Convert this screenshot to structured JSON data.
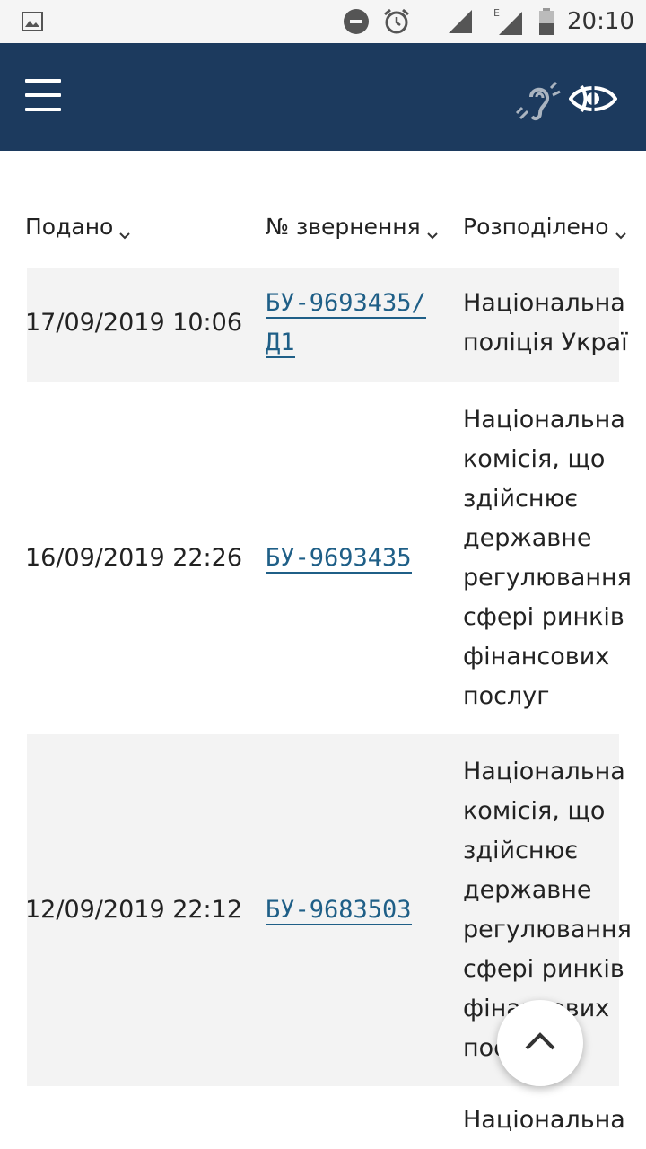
{
  "status_bar": {
    "time": "20:10",
    "network_label": "E",
    "icons": [
      "gallery-icon",
      "do-not-disturb-icon",
      "alarm-icon",
      "signal-icon",
      "signal-icon",
      "battery-icon"
    ]
  },
  "header": {
    "menu_icon": "hamburger-menu-icon",
    "accessibility_icons": [
      "hearing-accessibility-icon",
      "vision-accessibility-icon"
    ],
    "background_color": "#1c3a5e"
  },
  "table": {
    "columns": [
      "Подано",
      "№ звернення",
      "Розподілено"
    ],
    "rows": [
      {
        "submitted": "17/09/2019 10:06",
        "number": "БУ-9693435/Д1",
        "number_line1": "БУ-9693435/",
        "number_line2": "Д1",
        "distributed_lines": [
          "Національна",
          "поліція Украї"
        ]
      },
      {
        "submitted": "16/09/2019 22:26",
        "number": "БУ-9693435",
        "distributed_lines": [
          "Національна",
          "комісія, що",
          "здійснює",
          "державне",
          "регулювання",
          "сфері ринків",
          "фінансових",
          "послуг"
        ]
      },
      {
        "submitted": "12/09/2019 22:12",
        "number": "БУ-9683503",
        "distributed_lines": [
          "Національна",
          "комісія, що",
          "здійснює",
          "державне",
          "регулювання",
          "сфері ринків",
          "фінансових",
          "послуг"
        ]
      },
      {
        "submitted": "",
        "number": "",
        "distributed_lines": [
          "Національна"
        ]
      }
    ],
    "link_color": "#1f5f87",
    "row_shade_color": "#f3f3f3"
  },
  "scroll_top_icon": "chevron-up-icon"
}
